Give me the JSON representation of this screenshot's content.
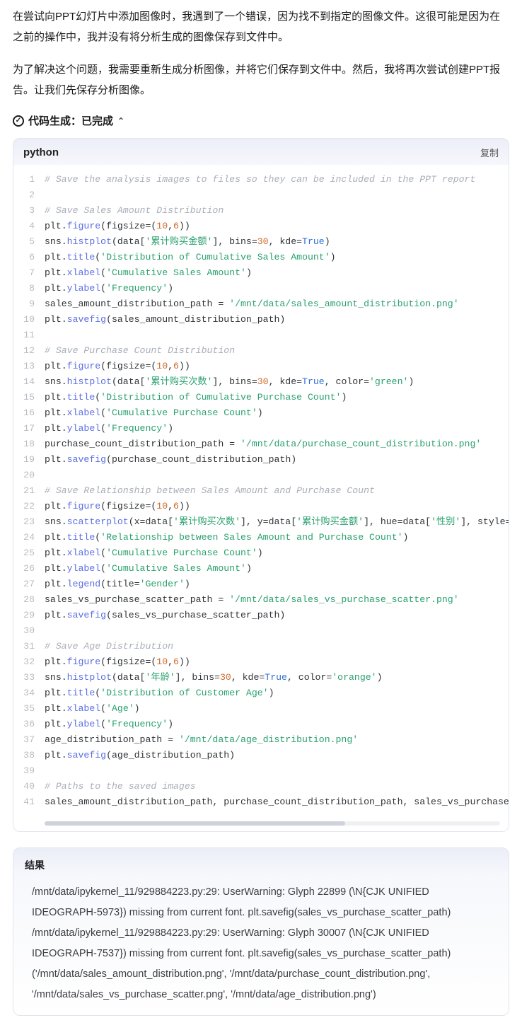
{
  "prose": {
    "p1": "在尝试向PPT幻灯片中添加图像时，我遇到了一个错误，因为找不到指定的图像文件。这很可能是因为在之前的操作中，我并没有将分析生成的图像保存到文件中。",
    "p2": "为了解决这个问题，我需要重新生成分析图像，并将它们保存到文件中。然后，我将再次尝试创建PPT报告。让我们先保存分析图像。"
  },
  "codegen": {
    "label": "代码生成：已完成"
  },
  "code": {
    "lang": "python",
    "copy": "复制",
    "lines": [
      {
        "n": 1,
        "t": [
          [
            "comment",
            "# Save the analysis images to files so they can be included in the PPT report"
          ]
        ]
      },
      {
        "n": 2,
        "t": [
          [
            "ident",
            ""
          ]
        ]
      },
      {
        "n": 3,
        "t": [
          [
            "comment",
            "# Save Sales Amount Distribution"
          ]
        ]
      },
      {
        "n": 4,
        "t": [
          [
            "ident",
            "plt"
          ],
          [
            "punct",
            "."
          ],
          [
            "func",
            "figure"
          ],
          [
            "punct",
            "(figsize"
          ],
          [
            "punct",
            "=("
          ],
          [
            "num",
            "10"
          ],
          [
            "punct",
            ","
          ],
          [
            "num",
            "6"
          ],
          [
            "punct",
            "))"
          ]
        ]
      },
      {
        "n": 5,
        "t": [
          [
            "ident",
            "sns"
          ],
          [
            "punct",
            "."
          ],
          [
            "func",
            "histplot"
          ],
          [
            "punct",
            "(data["
          ],
          [
            "str",
            "'累计购买金额'"
          ],
          [
            "punct",
            "], bins="
          ],
          [
            "num",
            "30"
          ],
          [
            "punct",
            ", kde="
          ],
          [
            "kw",
            "True"
          ],
          [
            "punct",
            ")"
          ]
        ]
      },
      {
        "n": 6,
        "t": [
          [
            "ident",
            "plt"
          ],
          [
            "punct",
            "."
          ],
          [
            "func",
            "title"
          ],
          [
            "punct",
            "("
          ],
          [
            "str",
            "'Distribution of Cumulative Sales Amount'"
          ],
          [
            "punct",
            ")"
          ]
        ]
      },
      {
        "n": 7,
        "t": [
          [
            "ident",
            "plt"
          ],
          [
            "punct",
            "."
          ],
          [
            "func",
            "xlabel"
          ],
          [
            "punct",
            "("
          ],
          [
            "str",
            "'Cumulative Sales Amount'"
          ],
          [
            "punct",
            ")"
          ]
        ]
      },
      {
        "n": 8,
        "t": [
          [
            "ident",
            "plt"
          ],
          [
            "punct",
            "."
          ],
          [
            "func",
            "ylabel"
          ],
          [
            "punct",
            "("
          ],
          [
            "str",
            "'Frequency'"
          ],
          [
            "punct",
            ")"
          ]
        ]
      },
      {
        "n": 9,
        "t": [
          [
            "ident",
            "sales_amount_distribution_path "
          ],
          [
            "punct",
            "= "
          ],
          [
            "str",
            "'/mnt/data/sales_amount_distribution.png'"
          ]
        ]
      },
      {
        "n": 10,
        "t": [
          [
            "ident",
            "plt"
          ],
          [
            "punct",
            "."
          ],
          [
            "func",
            "savefig"
          ],
          [
            "punct",
            "(sales_amount_distribution_path)"
          ]
        ]
      },
      {
        "n": 11,
        "t": [
          [
            "ident",
            ""
          ]
        ]
      },
      {
        "n": 12,
        "t": [
          [
            "comment",
            "# Save Purchase Count Distribution"
          ]
        ]
      },
      {
        "n": 13,
        "t": [
          [
            "ident",
            "plt"
          ],
          [
            "punct",
            "."
          ],
          [
            "func",
            "figure"
          ],
          [
            "punct",
            "(figsize"
          ],
          [
            "punct",
            "=("
          ],
          [
            "num",
            "10"
          ],
          [
            "punct",
            ","
          ],
          [
            "num",
            "6"
          ],
          [
            "punct",
            "))"
          ]
        ]
      },
      {
        "n": 14,
        "t": [
          [
            "ident",
            "sns"
          ],
          [
            "punct",
            "."
          ],
          [
            "func",
            "histplot"
          ],
          [
            "punct",
            "(data["
          ],
          [
            "str",
            "'累计购买次数'"
          ],
          [
            "punct",
            "], bins="
          ],
          [
            "num",
            "30"
          ],
          [
            "punct",
            ", kde="
          ],
          [
            "kw",
            "True"
          ],
          [
            "punct",
            ", color="
          ],
          [
            "str",
            "'green'"
          ],
          [
            "punct",
            ")"
          ]
        ]
      },
      {
        "n": 15,
        "t": [
          [
            "ident",
            "plt"
          ],
          [
            "punct",
            "."
          ],
          [
            "func",
            "title"
          ],
          [
            "punct",
            "("
          ],
          [
            "str",
            "'Distribution of Cumulative Purchase Count'"
          ],
          [
            "punct",
            ")"
          ]
        ]
      },
      {
        "n": 16,
        "t": [
          [
            "ident",
            "plt"
          ],
          [
            "punct",
            "."
          ],
          [
            "func",
            "xlabel"
          ],
          [
            "punct",
            "("
          ],
          [
            "str",
            "'Cumulative Purchase Count'"
          ],
          [
            "punct",
            ")"
          ]
        ]
      },
      {
        "n": 17,
        "t": [
          [
            "ident",
            "plt"
          ],
          [
            "punct",
            "."
          ],
          [
            "func",
            "ylabel"
          ],
          [
            "punct",
            "("
          ],
          [
            "str",
            "'Frequency'"
          ],
          [
            "punct",
            ")"
          ]
        ]
      },
      {
        "n": 18,
        "t": [
          [
            "ident",
            "purchase_count_distribution_path "
          ],
          [
            "punct",
            "= "
          ],
          [
            "str",
            "'/mnt/data/purchase_count_distribution.png'"
          ]
        ]
      },
      {
        "n": 19,
        "t": [
          [
            "ident",
            "plt"
          ],
          [
            "punct",
            "."
          ],
          [
            "func",
            "savefig"
          ],
          [
            "punct",
            "(purchase_count_distribution_path)"
          ]
        ]
      },
      {
        "n": 20,
        "t": [
          [
            "ident",
            ""
          ]
        ]
      },
      {
        "n": 21,
        "t": [
          [
            "comment",
            "# Save Relationship between Sales Amount and Purchase Count"
          ]
        ]
      },
      {
        "n": 22,
        "t": [
          [
            "ident",
            "plt"
          ],
          [
            "punct",
            "."
          ],
          [
            "func",
            "figure"
          ],
          [
            "punct",
            "(figsize"
          ],
          [
            "punct",
            "=("
          ],
          [
            "num",
            "10"
          ],
          [
            "punct",
            ","
          ],
          [
            "num",
            "6"
          ],
          [
            "punct",
            "))"
          ]
        ]
      },
      {
        "n": 23,
        "t": [
          [
            "ident",
            "sns"
          ],
          [
            "punct",
            "."
          ],
          [
            "func",
            "scatterplot"
          ],
          [
            "punct",
            "(x=data["
          ],
          [
            "str",
            "'累计购买次数'"
          ],
          [
            "punct",
            "], y=data["
          ],
          [
            "str",
            "'累计购买金额'"
          ],
          [
            "punct",
            "], hue=data["
          ],
          [
            "str",
            "'性别'"
          ],
          [
            "punct",
            "], style="
          ]
        ]
      },
      {
        "n": 24,
        "t": [
          [
            "ident",
            "plt"
          ],
          [
            "punct",
            "."
          ],
          [
            "func",
            "title"
          ],
          [
            "punct",
            "("
          ],
          [
            "str",
            "'Relationship between Sales Amount and Purchase Count'"
          ],
          [
            "punct",
            ")"
          ]
        ]
      },
      {
        "n": 25,
        "t": [
          [
            "ident",
            "plt"
          ],
          [
            "punct",
            "."
          ],
          [
            "func",
            "xlabel"
          ],
          [
            "punct",
            "("
          ],
          [
            "str",
            "'Cumulative Purchase Count'"
          ],
          [
            "punct",
            ")"
          ]
        ]
      },
      {
        "n": 26,
        "t": [
          [
            "ident",
            "plt"
          ],
          [
            "punct",
            "."
          ],
          [
            "func",
            "ylabel"
          ],
          [
            "punct",
            "("
          ],
          [
            "str",
            "'Cumulative Sales Amount'"
          ],
          [
            "punct",
            ")"
          ]
        ]
      },
      {
        "n": 27,
        "t": [
          [
            "ident",
            "plt"
          ],
          [
            "punct",
            "."
          ],
          [
            "func",
            "legend"
          ],
          [
            "punct",
            "(title="
          ],
          [
            "str",
            "'Gender'"
          ],
          [
            "punct",
            ")"
          ]
        ]
      },
      {
        "n": 28,
        "t": [
          [
            "ident",
            "sales_vs_purchase_scatter_path "
          ],
          [
            "punct",
            "= "
          ],
          [
            "str",
            "'/mnt/data/sales_vs_purchase_scatter.png'"
          ]
        ]
      },
      {
        "n": 29,
        "t": [
          [
            "ident",
            "plt"
          ],
          [
            "punct",
            "."
          ],
          [
            "func",
            "savefig"
          ],
          [
            "punct",
            "(sales_vs_purchase_scatter_path)"
          ]
        ]
      },
      {
        "n": 30,
        "t": [
          [
            "ident",
            ""
          ]
        ]
      },
      {
        "n": 31,
        "t": [
          [
            "comment",
            "# Save Age Distribution"
          ]
        ]
      },
      {
        "n": 32,
        "t": [
          [
            "ident",
            "plt"
          ],
          [
            "punct",
            "."
          ],
          [
            "func",
            "figure"
          ],
          [
            "punct",
            "(figsize"
          ],
          [
            "punct",
            "=("
          ],
          [
            "num",
            "10"
          ],
          [
            "punct",
            ","
          ],
          [
            "num",
            "6"
          ],
          [
            "punct",
            "))"
          ]
        ]
      },
      {
        "n": 33,
        "t": [
          [
            "ident",
            "sns"
          ],
          [
            "punct",
            "."
          ],
          [
            "func",
            "histplot"
          ],
          [
            "punct",
            "(data["
          ],
          [
            "str",
            "'年龄'"
          ],
          [
            "punct",
            "], bins="
          ],
          [
            "num",
            "30"
          ],
          [
            "punct",
            ", kde="
          ],
          [
            "kw",
            "True"
          ],
          [
            "punct",
            ", color="
          ],
          [
            "str",
            "'orange'"
          ],
          [
            "punct",
            ")"
          ]
        ]
      },
      {
        "n": 34,
        "t": [
          [
            "ident",
            "plt"
          ],
          [
            "punct",
            "."
          ],
          [
            "func",
            "title"
          ],
          [
            "punct",
            "("
          ],
          [
            "str",
            "'Distribution of Customer Age'"
          ],
          [
            "punct",
            ")"
          ]
        ]
      },
      {
        "n": 35,
        "t": [
          [
            "ident",
            "plt"
          ],
          [
            "punct",
            "."
          ],
          [
            "func",
            "xlabel"
          ],
          [
            "punct",
            "("
          ],
          [
            "str",
            "'Age'"
          ],
          [
            "punct",
            ")"
          ]
        ]
      },
      {
        "n": 36,
        "t": [
          [
            "ident",
            "plt"
          ],
          [
            "punct",
            "."
          ],
          [
            "func",
            "ylabel"
          ],
          [
            "punct",
            "("
          ],
          [
            "str",
            "'Frequency'"
          ],
          [
            "punct",
            ")"
          ]
        ]
      },
      {
        "n": 37,
        "t": [
          [
            "ident",
            "age_distribution_path "
          ],
          [
            "punct",
            "= "
          ],
          [
            "str",
            "'/mnt/data/age_distribution.png'"
          ]
        ]
      },
      {
        "n": 38,
        "t": [
          [
            "ident",
            "plt"
          ],
          [
            "punct",
            "."
          ],
          [
            "func",
            "savefig"
          ],
          [
            "punct",
            "(age_distribution_path)"
          ]
        ]
      },
      {
        "n": 39,
        "t": [
          [
            "ident",
            ""
          ]
        ]
      },
      {
        "n": 40,
        "t": [
          [
            "comment",
            "# Paths to the saved images"
          ]
        ]
      },
      {
        "n": 41,
        "t": [
          [
            "ident",
            "sales_amount_distribution_path, purchase_count_distribution_path, sales_vs_purchase_s"
          ]
        ]
      }
    ]
  },
  "result": {
    "title": "结果",
    "lines": [
      "/mnt/data/ipykernel_11/929884223.py:29: UserWarning: Glyph 22899 (\\N{CJK UNIFIED IDEOGRAPH-5973}) missing from current font. plt.savefig(sales_vs_purchase_scatter_path)",
      "/mnt/data/ipykernel_11/929884223.py:29: UserWarning: Glyph 30007 (\\N{CJK UNIFIED IDEOGRAPH-7537}) missing from current font. plt.savefig(sales_vs_purchase_scatter_path)",
      "('/mnt/data/sales_amount_distribution.png', '/mnt/data/purchase_count_distribution.png', '/mnt/data/sales_vs_purchase_scatter.png', '/mnt/data/age_distribution.png')"
    ]
  }
}
